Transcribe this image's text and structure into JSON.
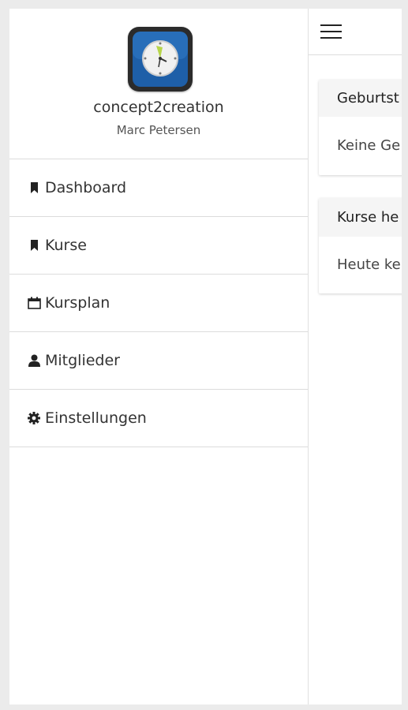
{
  "app": {
    "name": "concept2creation",
    "user": "Marc Petersen"
  },
  "menu": {
    "items": [
      {
        "label": "Dashboard",
        "icon": "bookmark-icon"
      },
      {
        "label": "Kurse",
        "icon": "bookmark-icon"
      },
      {
        "label": "Kursplan",
        "icon": "calendar-icon"
      },
      {
        "label": "Mitglieder",
        "icon": "user-icon"
      },
      {
        "label": "Einstellungen",
        "icon": "gear-icon"
      }
    ]
  },
  "main": {
    "cards": [
      {
        "title": "Geburtst",
        "body": "Keine Ge"
      },
      {
        "title": "Kurse he",
        "body": "Heute ke"
      }
    ]
  },
  "colors": {
    "icon_blue": "#1e5fa8",
    "icon_frame": "#2b2b2b",
    "clock_hand": "#b7d54a",
    "divider": "#dcdcdc",
    "card_header": "#f5f5f5"
  }
}
